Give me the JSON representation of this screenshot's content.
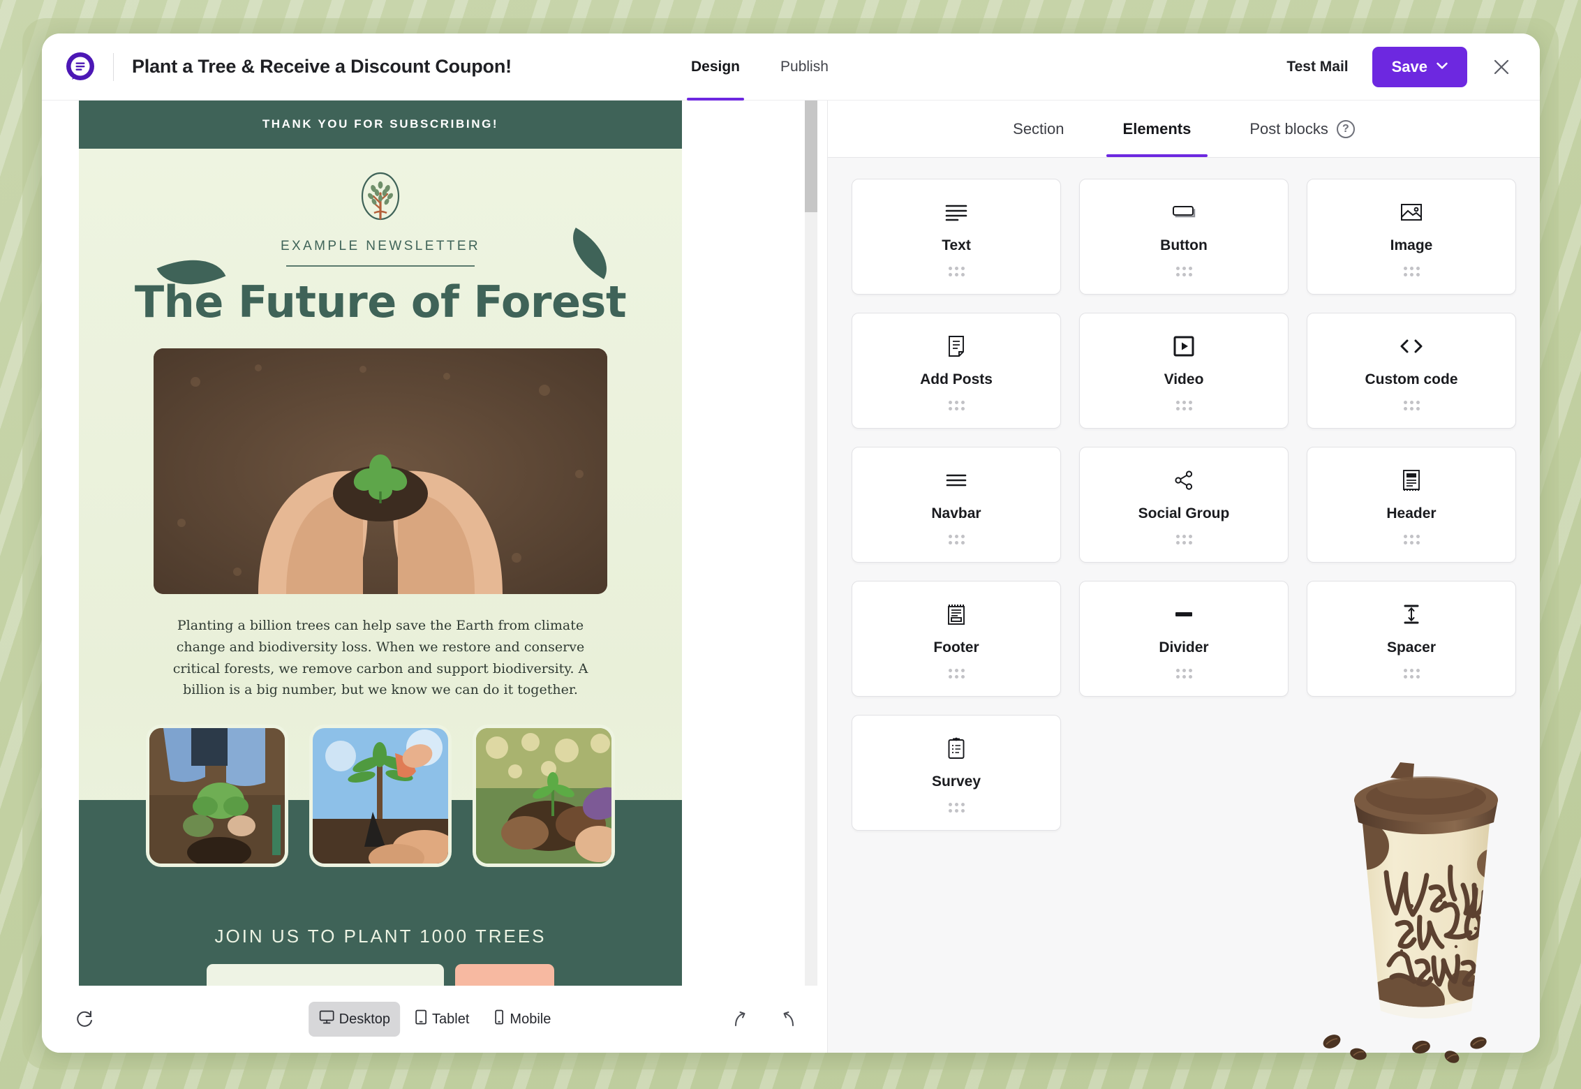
{
  "app": {
    "logo_icon": "chat-list-logo-icon",
    "doc_title": "Plant a Tree & Receive a Discount Coupon!",
    "brand_purple": "#6d28e0"
  },
  "top_tabs": [
    {
      "label": "Design",
      "active": true
    },
    {
      "label": "Publish",
      "active": false
    }
  ],
  "top_actions": {
    "test_mail_label": "Test Mail",
    "save_label": "Save",
    "save_caret": "⌄",
    "close_icon": "close-icon"
  },
  "panel": {
    "tabs": [
      {
        "label": "Section",
        "active": false
      },
      {
        "label": "Elements",
        "active": true
      },
      {
        "label": "Post blocks",
        "active": false
      }
    ],
    "help_icon_label": "?",
    "elements": [
      {
        "label": "Text",
        "icon": "text-lines-icon"
      },
      {
        "label": "Button",
        "icon": "button-icon"
      },
      {
        "label": "Image",
        "icon": "image-icon"
      },
      {
        "label": "Add Posts",
        "icon": "document-page-icon"
      },
      {
        "label": "Video",
        "icon": "video-play-icon"
      },
      {
        "label": "Custom code",
        "icon": "code-brackets-icon"
      },
      {
        "label": "Navbar",
        "icon": "hamburger-menu-icon"
      },
      {
        "label": "Social Group",
        "icon": "share-nodes-icon"
      },
      {
        "label": "Header",
        "icon": "header-block-icon"
      },
      {
        "label": "Footer",
        "icon": "footer-block-icon"
      },
      {
        "label": "Divider",
        "icon": "divider-bar-icon"
      },
      {
        "label": "Spacer",
        "icon": "spacer-arrows-icon"
      },
      {
        "label": "Survey",
        "icon": "clipboard-survey-icon"
      }
    ]
  },
  "canvas_toolbar": {
    "refresh_icon": "refresh-icon",
    "devices": [
      {
        "label": "Desktop",
        "icon": "desktop-icon",
        "active": true
      },
      {
        "label": "Tablet",
        "icon": "tablet-icon",
        "active": false
      },
      {
        "label": "Mobile",
        "icon": "mobile-icon",
        "active": false
      }
    ],
    "redo_icon": "redo-arrow-icon",
    "undo_icon": "undo-arrow-icon"
  },
  "email": {
    "topbar_text": "THANK YOU FOR SUBSCRIBING!",
    "brand_name": "EXAMPLE NEWSLETTER",
    "headline": "The Future of Forest",
    "body_copy": "Planting a billion trees can help save the Earth from climate change and biodiversity loss. When we restore and conserve critical forests, we remove carbon and support biodiversity. A billion is a big number, but we know we can do it together.",
    "join_text": "JOIN US TO PLANT 1000 TREES",
    "hero_image_alt": "hands-cupping-seedling-in-soil",
    "thumb_alts": [
      "person-planting-sapling-in-hole",
      "hands-with-trowel-planting-young-tree",
      "hands-holding-seedling-with-roots"
    ],
    "colors": {
      "dark_green": "#3f6358",
      "cream": "#eef4e1",
      "cta_peach": "#f7b9a1"
    }
  },
  "overlay": {
    "coffee_cup_text_line1": "Wake up",
    "coffee_cup_text_line2": "and Be",
    "coffee_cup_text_line3": "Awesome",
    "coffee_cup_alt": "takeaway-coffee-cup-illustration"
  }
}
